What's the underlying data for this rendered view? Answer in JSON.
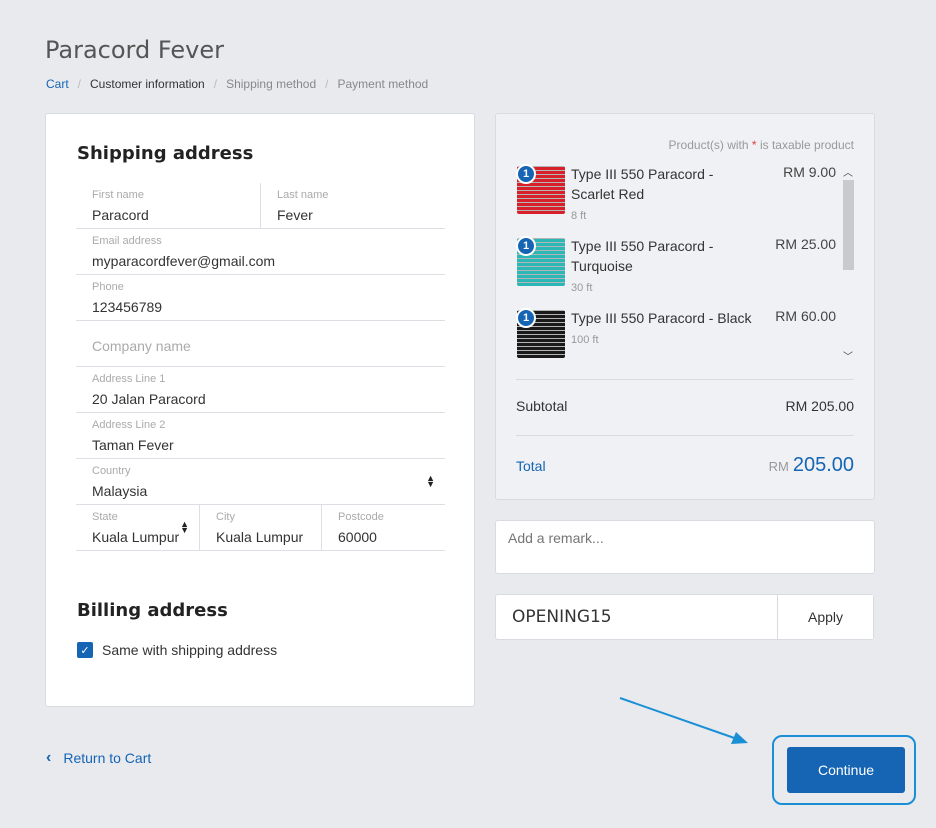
{
  "store": {
    "title": "Paracord Fever"
  },
  "breadcrumb": {
    "cart": "Cart",
    "customer_information": "Customer information",
    "shipping_method": "Shipping method",
    "payment_method": "Payment method",
    "separator": "/"
  },
  "shipping": {
    "title": "Shipping address",
    "first_name": {
      "label": "First name",
      "value": "Paracord"
    },
    "last_name": {
      "label": "Last name",
      "value": "Fever"
    },
    "email": {
      "label": "Email address",
      "value": "myparacordfever@gmail.com"
    },
    "phone": {
      "label": "Phone",
      "value": "123456789"
    },
    "company": {
      "placeholder": "Company name"
    },
    "address1": {
      "label": "Address Line 1",
      "value": "20 Jalan Paracord"
    },
    "address2": {
      "label": "Address Line 2",
      "value": "Taman Fever"
    },
    "country": {
      "label": "Country",
      "value": "Malaysia"
    },
    "state": {
      "label": "State",
      "value": "Kuala Lumpur"
    },
    "city": {
      "label": "City",
      "value": "Kuala Lumpur"
    },
    "postcode": {
      "label": "Postcode",
      "value": "60000"
    }
  },
  "billing": {
    "title": "Billing address",
    "same_label": "Same with shipping address",
    "same_checked": true
  },
  "summary": {
    "tax_note_prefix": "Product(s) with",
    "tax_note_star": "*",
    "tax_note_suffix": "is taxable product",
    "items": [
      {
        "qty": "1",
        "name": "Type III 550 Paracord - Scarlet Red",
        "variant": "8 ft",
        "price": "RM 9.00",
        "color": "#d8202a"
      },
      {
        "qty": "1",
        "name": "Type III 550 Paracord - Turquoise",
        "variant": "30 ft",
        "price": "RM 25.00",
        "color": "#2ab7b5"
      },
      {
        "qty": "1",
        "name": "Type III 550 Paracord - Black",
        "variant": "100 ft",
        "price": "RM 60.00",
        "color": "#1a1a1a"
      }
    ],
    "subtotal_label": "Subtotal",
    "subtotal_value": "RM 205.00",
    "total_label": "Total",
    "total_currency": "RM",
    "total_amount": "205.00"
  },
  "remark": {
    "placeholder": "Add a remark..."
  },
  "coupon": {
    "value": "OPENING15",
    "apply_label": "Apply"
  },
  "nav": {
    "return_label": "Return to Cart",
    "continue_label": "Continue"
  },
  "colors": {
    "accent": "#1565b4",
    "highlight": "#1a8fd6",
    "background": "#e8eaee"
  }
}
